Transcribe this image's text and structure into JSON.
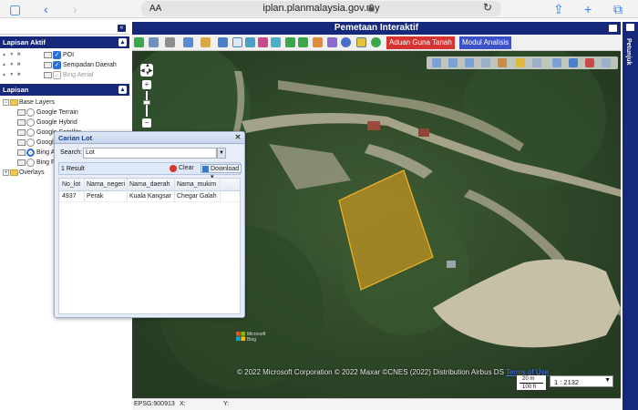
{
  "browser": {
    "text_size_label": "AA",
    "url": "iplan.planmalaysia.gov.my",
    "icons": [
      "sidebar-icon",
      "back-icon",
      "forward-icon",
      "lock-icon",
      "reload-icon",
      "share-icon",
      "new-tab-icon",
      "tabs-icon"
    ]
  },
  "layers_panel": {
    "title": "Lapisan Aktif",
    "items": [
      {
        "label": "POI",
        "checked": true
      },
      {
        "label": "Sempadan Daerah",
        "checked": true
      },
      {
        "label": "Bing Aerial",
        "checked": false
      }
    ]
  },
  "tree_panel": {
    "title": "Lapisan",
    "base_layers_label": "Base Layers",
    "base_layers": [
      {
        "label": "Google Terrain",
        "selected": false
      },
      {
        "label": "Google Hybrid",
        "selected": false
      },
      {
        "label": "Google Satellite",
        "selected": false
      },
      {
        "label": "Google",
        "selected": false
      },
      {
        "label": "Bing A",
        "selected": true
      },
      {
        "label": "Bing R",
        "selected": false
      }
    ],
    "overlays_label": "Overlays"
  },
  "map": {
    "title": "Pemetaan Interaktif",
    "side_tab": "Petunjuk",
    "btn_aduan": "Aduan Guna Tanah",
    "btn_modul": "Modul Analisis",
    "copyright": "© 2022 Microsoft Corporation © 2022 Maxar ©CNES (2022) Distribution Airbus DS",
    "terms": "Terms of Use",
    "scale_top": "20 m",
    "scale_bottom": "100 ft",
    "zoom_value": "1 : 2132",
    "ms_text_1": "Microsoft",
    "ms_text_2": "Bing",
    "parcel_color": "#f2a81d",
    "accent": "#16287a"
  },
  "dialog": {
    "title": "Carian Lot",
    "search_label": "Search:",
    "search_value": "Lot",
    "result_count": "1 Result",
    "clear_label": "Clear",
    "download_label": "Download",
    "columns": [
      "No_lot",
      "Nama_negeri",
      "Nama_daerah",
      "Nama_mukim"
    ],
    "rows": [
      [
        "4937",
        "Perak",
        "Kuala Kangsar",
        "Chegar Galah"
      ]
    ]
  },
  "status": {
    "epsg": "EPSG:900913",
    "x_label": "X:",
    "y_label": "Y:"
  }
}
